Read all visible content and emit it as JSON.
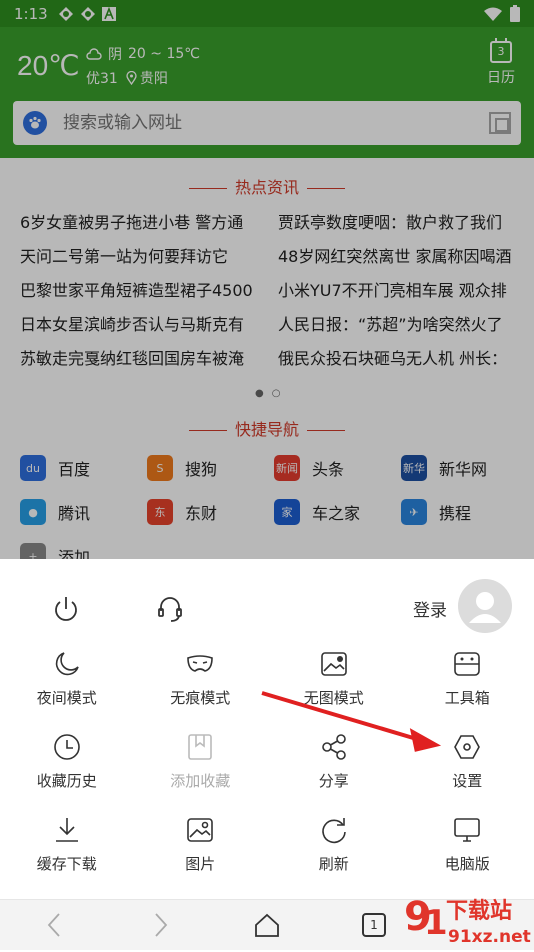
{
  "status_bar": {
    "time": "1:13",
    "icons": [
      "app-icon",
      "app-icon",
      "a-icon"
    ],
    "right_icons": [
      "wifi-icon",
      "battery-icon"
    ]
  },
  "header": {
    "temperature": "20℃",
    "condition": "阴",
    "range": "20 ~ 15℃",
    "air_quality": "优31",
    "location": "贵阳",
    "calendar_day": "3",
    "calendar_label": "日历"
  },
  "search": {
    "placeholder": "搜索或输入网址"
  },
  "hot_news": {
    "title": "热点资讯",
    "items": [
      "6岁女童被男子拖进小巷 警方通",
      "贾跃亭数度哽咽：散户救了我们",
      "天问二号第一站为何要拜访它",
      "48岁网红突然离世 家属称因喝酒",
      "巴黎世家平角短裤造型裙子4500",
      "小米YU7不开门亮相车展 观众排",
      "日本女星滨崎步否认与马斯克有",
      "人民日报：“苏超”为啥突然火了",
      "苏敏走完戛纳红毯回国房车被淹",
      "俄民众投石块砸乌无人机 州长："
    ]
  },
  "quick_nav": {
    "title": "快捷导航",
    "items": [
      {
        "label": "百度",
        "icon": "baidu-icon",
        "color": "#2f6fe0",
        "glyph": "du"
      },
      {
        "label": "搜狗",
        "icon": "sogou-icon",
        "color": "#f07a1c",
        "glyph": "S"
      },
      {
        "label": "头条",
        "icon": "toutiao-icon",
        "color": "#e63c2f",
        "glyph": "新闻"
      },
      {
        "label": "新华网",
        "icon": "xinhua-icon",
        "color": "#1c4fa3",
        "glyph": "新华"
      },
      {
        "label": "腾讯",
        "icon": "tencent-icon",
        "color": "#27a0e8",
        "glyph": "●"
      },
      {
        "label": "东财",
        "icon": "dongcai-icon",
        "color": "#e8432c",
        "glyph": "东"
      },
      {
        "label": "车之家",
        "icon": "autohome-icon",
        "color": "#1d5fd3",
        "glyph": "家"
      },
      {
        "label": "携程",
        "icon": "ctrip-icon",
        "color": "#2a86e0",
        "glyph": "✈"
      },
      {
        "label": "添加",
        "icon": "add-icon",
        "color": "#8a8a8a",
        "glyph": "+"
      }
    ]
  },
  "sheet": {
    "login_label": "登录",
    "menu": [
      {
        "label": "夜间模式",
        "icon": "moon-icon",
        "enabled": true
      },
      {
        "label": "无痕模式",
        "icon": "mask-icon",
        "enabled": true
      },
      {
        "label": "无图模式",
        "icon": "no-image-icon",
        "enabled": true
      },
      {
        "label": "工具箱",
        "icon": "toolbox-icon",
        "enabled": true
      },
      {
        "label": "收藏历史",
        "icon": "clock-icon",
        "enabled": true
      },
      {
        "label": "添加收藏",
        "icon": "bookmark-icon",
        "enabled": false
      },
      {
        "label": "分享",
        "icon": "share-icon",
        "enabled": true
      },
      {
        "label": "设置",
        "icon": "settings-hexagon-icon",
        "enabled": true
      },
      {
        "label": "缓存下载",
        "icon": "download-icon",
        "enabled": true
      },
      {
        "label": "图片",
        "icon": "image-icon",
        "enabled": true
      },
      {
        "label": "刷新",
        "icon": "refresh-icon",
        "enabled": true
      },
      {
        "label": "电脑版",
        "icon": "desktop-icon",
        "enabled": true
      }
    ]
  },
  "navbar": {
    "tab_count": "1"
  },
  "watermark": {
    "text": "91下载站",
    "sub": "91xz.net"
  },
  "colors": {
    "header_green": "#3aa02b",
    "status_green": "#2f8f1f",
    "accent_red": "#d23b2a"
  }
}
